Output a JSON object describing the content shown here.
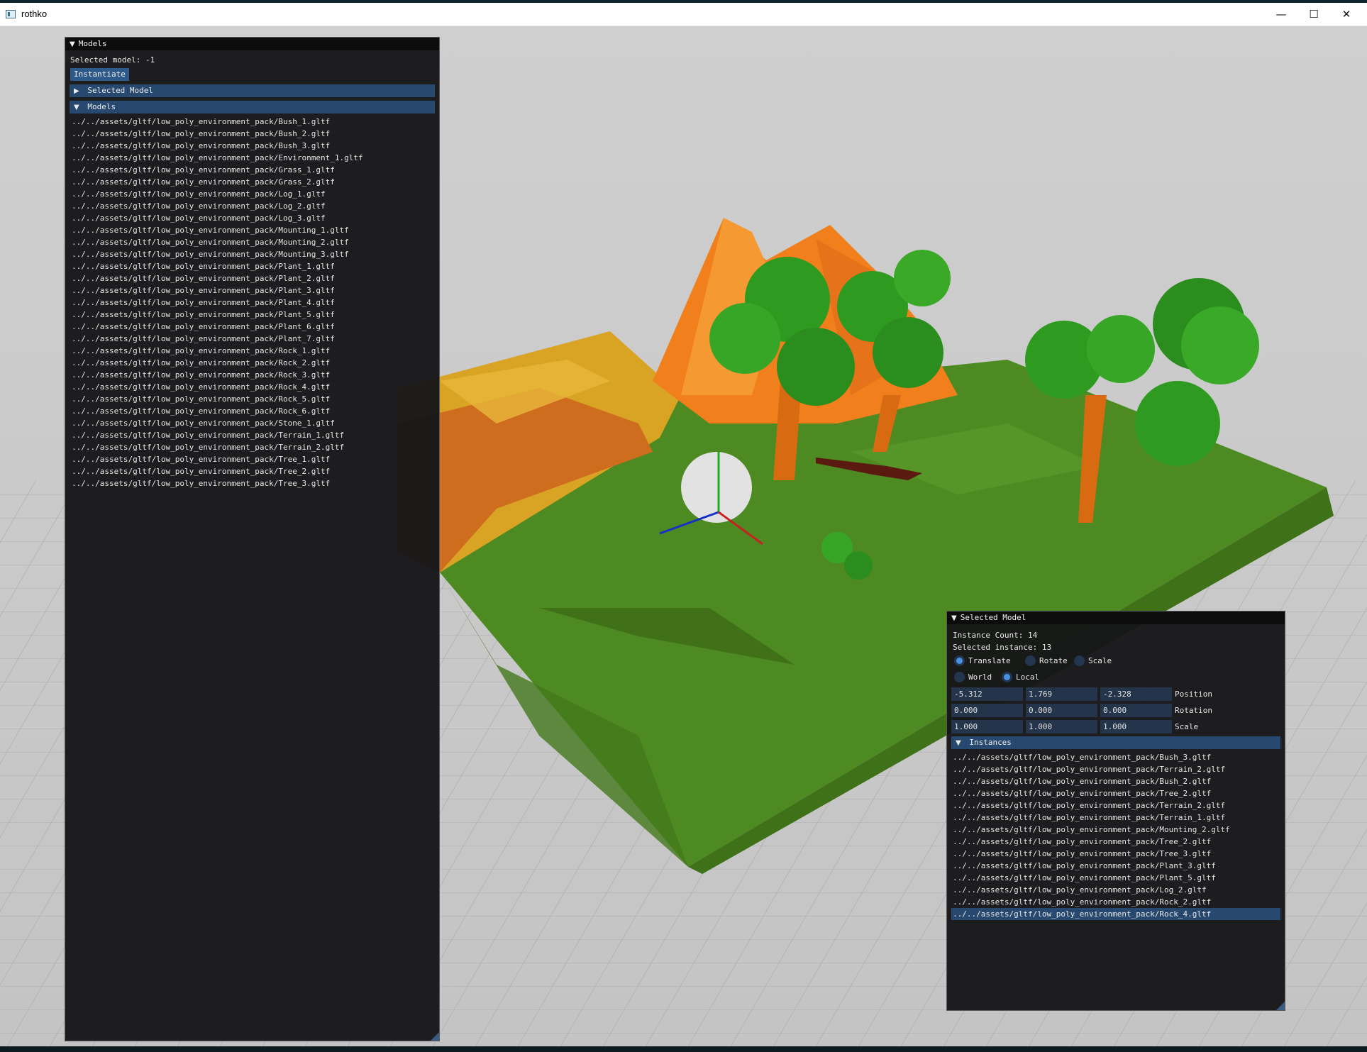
{
  "window": {
    "title": "rothko"
  },
  "models_panel": {
    "title": "Models",
    "selected_model_text": "Selected model: -1",
    "instantiate_label": "Instantiate",
    "selected_model_header": "Selected Model",
    "models_header": "Models",
    "items": [
      "../../assets/gltf/low_poly_environment_pack/Bush_1.gltf",
      "../../assets/gltf/low_poly_environment_pack/Bush_2.gltf",
      "../../assets/gltf/low_poly_environment_pack/Bush_3.gltf",
      "../../assets/gltf/low_poly_environment_pack/Environment_1.gltf",
      "../../assets/gltf/low_poly_environment_pack/Grass_1.gltf",
      "../../assets/gltf/low_poly_environment_pack/Grass_2.gltf",
      "../../assets/gltf/low_poly_environment_pack/Log_1.gltf",
      "../../assets/gltf/low_poly_environment_pack/Log_2.gltf",
      "../../assets/gltf/low_poly_environment_pack/Log_3.gltf",
      "../../assets/gltf/low_poly_environment_pack/Mounting_1.gltf",
      "../../assets/gltf/low_poly_environment_pack/Mounting_2.gltf",
      "../../assets/gltf/low_poly_environment_pack/Mounting_3.gltf",
      "../../assets/gltf/low_poly_environment_pack/Plant_1.gltf",
      "../../assets/gltf/low_poly_environment_pack/Plant_2.gltf",
      "../../assets/gltf/low_poly_environment_pack/Plant_3.gltf",
      "../../assets/gltf/low_poly_environment_pack/Plant_4.gltf",
      "../../assets/gltf/low_poly_environment_pack/Plant_5.gltf",
      "../../assets/gltf/low_poly_environment_pack/Plant_6.gltf",
      "../../assets/gltf/low_poly_environment_pack/Plant_7.gltf",
      "../../assets/gltf/low_poly_environment_pack/Rock_1.gltf",
      "../../assets/gltf/low_poly_environment_pack/Rock_2.gltf",
      "../../assets/gltf/low_poly_environment_pack/Rock_3.gltf",
      "../../assets/gltf/low_poly_environment_pack/Rock_4.gltf",
      "../../assets/gltf/low_poly_environment_pack/Rock_5.gltf",
      "../../assets/gltf/low_poly_environment_pack/Rock_6.gltf",
      "../../assets/gltf/low_poly_environment_pack/Stone_1.gltf",
      "../../assets/gltf/low_poly_environment_pack/Terrain_1.gltf",
      "../../assets/gltf/low_poly_environment_pack/Terrain_2.gltf",
      "../../assets/gltf/low_poly_environment_pack/Tree_1.gltf",
      "../../assets/gltf/low_poly_environment_pack/Tree_2.gltf",
      "../../assets/gltf/low_poly_environment_pack/Tree_3.gltf"
    ]
  },
  "selected_panel": {
    "title": "Selected Model",
    "instance_count_text": "Instance Count: 14",
    "selected_instance_text": "Selected instance: 13",
    "modes": [
      {
        "label": "Translate",
        "on": true
      },
      {
        "label": "Rotate",
        "on": false
      },
      {
        "label": "Scale",
        "on": false
      }
    ],
    "spaces": [
      {
        "label": "World",
        "on": false
      },
      {
        "label": "Local",
        "on": true
      }
    ],
    "rows": [
      {
        "label": "Position",
        "values": [
          "-5.312",
          "1.769",
          "-2.328"
        ]
      },
      {
        "label": "Rotation",
        "values": [
          "0.000",
          "0.000",
          "0.000"
        ]
      },
      {
        "label": "Scale",
        "values": [
          "1.000",
          "1.000",
          "1.000"
        ]
      }
    ],
    "instances_header": "Instances",
    "instances": [
      "../../assets/gltf/low_poly_environment_pack/Bush_3.gltf",
      "../../assets/gltf/low_poly_environment_pack/Terrain_2.gltf",
      "../../assets/gltf/low_poly_environment_pack/Bush_2.gltf",
      "../../assets/gltf/low_poly_environment_pack/Tree_2.gltf",
      "../../assets/gltf/low_poly_environment_pack/Terrain_2.gltf",
      "../../assets/gltf/low_poly_environment_pack/Terrain_1.gltf",
      "../../assets/gltf/low_poly_environment_pack/Mounting_2.gltf",
      "../../assets/gltf/low_poly_environment_pack/Tree_2.gltf",
      "../../assets/gltf/low_poly_environment_pack/Tree_3.gltf",
      "../../assets/gltf/low_poly_environment_pack/Plant_3.gltf",
      "../../assets/gltf/low_poly_environment_pack/Plant_5.gltf",
      "../../assets/gltf/low_poly_environment_pack/Log_2.gltf",
      "../../assets/gltf/low_poly_environment_pack/Rock_2.gltf",
      "../../assets/gltf/low_poly_environment_pack/Rock_4.gltf"
    ],
    "selected_instance_index": 13
  },
  "colors": {
    "accent": "#27496f",
    "button": "#2d5a8a",
    "radio_on": "#4a8fe0",
    "panel_bg": "#161618"
  }
}
